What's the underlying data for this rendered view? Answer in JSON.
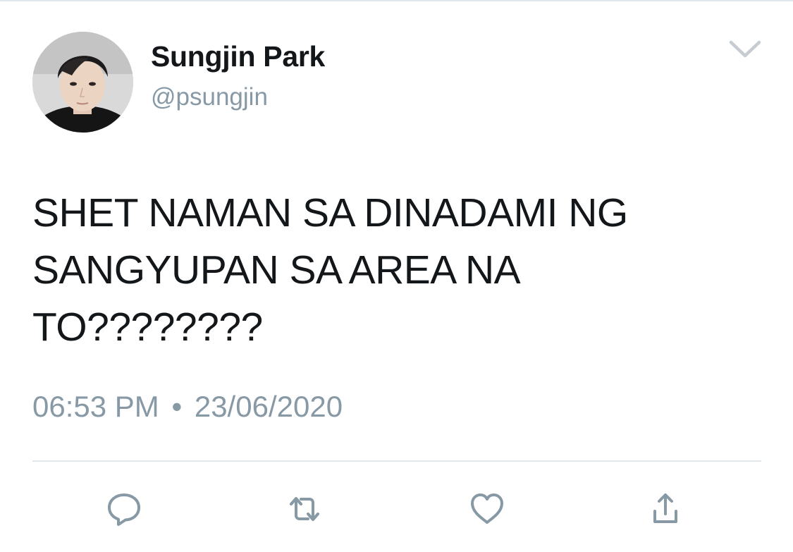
{
  "user": {
    "display_name": "Sungjin Park",
    "handle": "@psungjin"
  },
  "tweet": {
    "lines": [
      "SHET NAMAN SA DINADAMI NG",
      "SANGYUPAN SA AREA NA",
      "TO????????"
    ],
    "time": "06:53 PM",
    "separator": "•",
    "date": "23/06/2020"
  },
  "icons": {
    "menu": "chevron-down-icon",
    "actions": [
      "reply-icon",
      "retweet-icon",
      "like-icon",
      "share-icon"
    ]
  },
  "colors": {
    "text": "#14171a",
    "secondary": "#8899a6",
    "divider": "#e1e8ed",
    "icon": "#8899a6"
  }
}
